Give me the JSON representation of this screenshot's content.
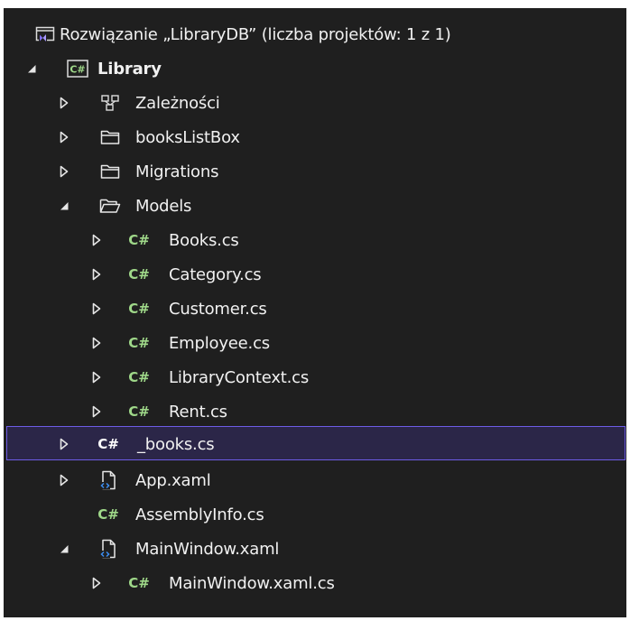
{
  "solution": {
    "label": "Rozwiązanie „LibraryDB” (liczba projektów: 1 z 1)",
    "icon": "solution-icon"
  },
  "project": {
    "label": "Library",
    "icon": "csharp-project-icon",
    "expanded": true
  },
  "nodes": [
    {
      "label": "Zależności",
      "icon": "dependencies-icon",
      "expander": "collapsed"
    },
    {
      "label": "booksListBox",
      "icon": "folder-icon",
      "expander": "collapsed"
    },
    {
      "label": "Migrations",
      "icon": "folder-icon",
      "expander": "collapsed"
    },
    {
      "label": "Models",
      "icon": "folder-open-icon",
      "expander": "expanded"
    },
    {
      "label": "Books.cs",
      "icon": "csharp-file-icon",
      "expander": "collapsed"
    },
    {
      "label": "Category.cs",
      "icon": "csharp-file-icon",
      "expander": "collapsed"
    },
    {
      "label": "Customer.cs",
      "icon": "csharp-file-icon",
      "expander": "collapsed"
    },
    {
      "label": "Employee.cs",
      "icon": "csharp-file-icon",
      "expander": "collapsed"
    },
    {
      "label": "LibraryContext.cs",
      "icon": "csharp-file-icon",
      "expander": "collapsed"
    },
    {
      "label": "Rent.cs",
      "icon": "csharp-file-icon",
      "expander": "collapsed"
    },
    {
      "label": "_books.cs",
      "icon": "csharp-file-icon",
      "expander": "collapsed",
      "selected": true
    },
    {
      "label": "App.xaml",
      "icon": "xaml-file-icon",
      "expander": "collapsed"
    },
    {
      "label": "AssemblyInfo.cs",
      "icon": "csharp-file-icon",
      "expander": "none"
    },
    {
      "label": "MainWindow.xaml",
      "icon": "xaml-file-icon",
      "expander": "expanded"
    },
    {
      "label": "MainWindow.xaml.cs",
      "icon": "csharp-file-icon",
      "expander": "collapsed"
    }
  ],
  "glyphs": {
    "csharp": "C#",
    "project_badge": "C#"
  },
  "colors": {
    "background": "#1f1f1f",
    "text": "#f1f1f1",
    "csharp_green": "#9fd889",
    "selection_fill": "#2b2648",
    "selection_border": "#6d5ce6",
    "folder": "#e8e8e8",
    "solution_accent": "#7f6ff0",
    "xaml_accent": "#3c8df0"
  }
}
